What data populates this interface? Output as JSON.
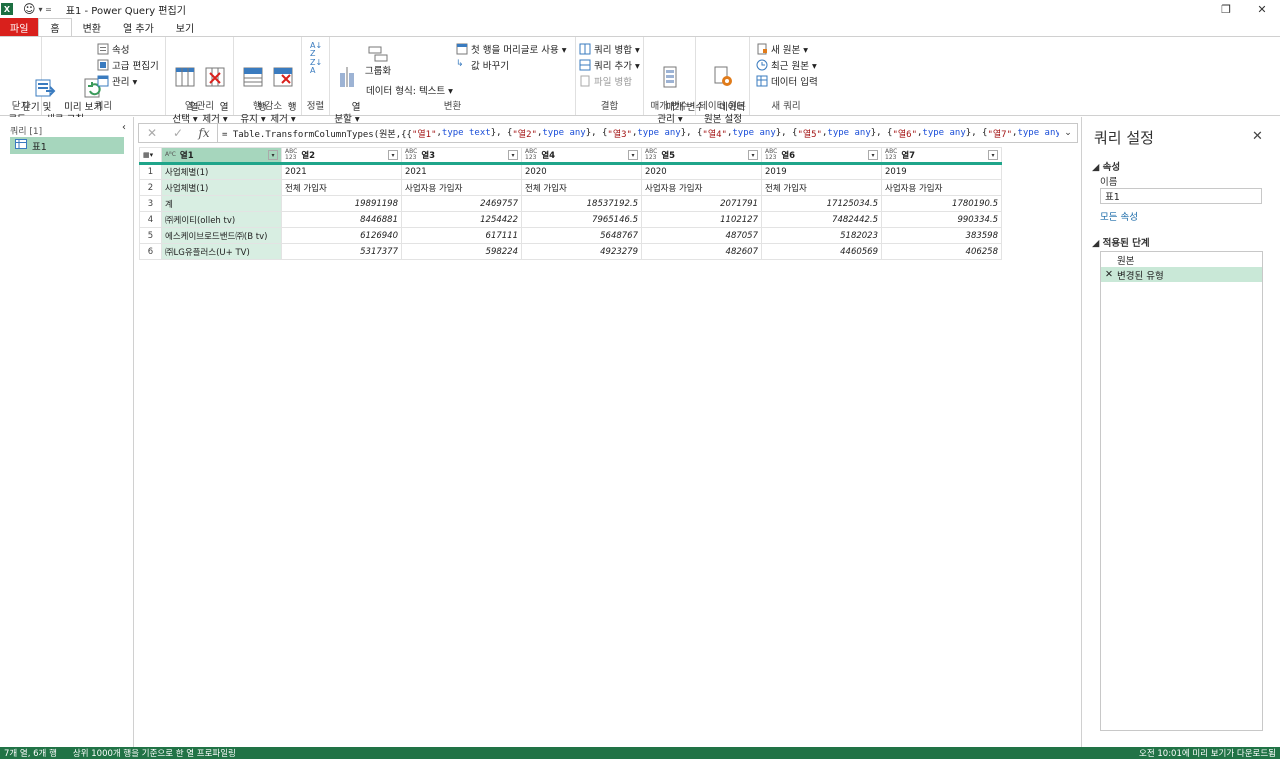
{
  "window": {
    "title": "표1 - Power Query 편집기",
    "xl": "X",
    "qa_arrow": "▾ ="
  },
  "tabs": [
    {
      "label": "파일"
    },
    {
      "label": "홈"
    },
    {
      "label": "변환"
    },
    {
      "label": "열 추가"
    },
    {
      "label": "보기"
    }
  ],
  "ribbon": {
    "close_load": "닫기 및\n로드 ▾",
    "refresh_preview": "미리 보기\n새로 고침 ▾",
    "properties": "속성",
    "advanced_editor": "고급 편집기",
    "manage": "관리 ▾",
    "choose_columns": "열\n선택 ▾",
    "remove_columns": "열\n제거 ▾",
    "keep_rows": "행\n유지 ▾",
    "remove_rows": "행\n제거 ▾",
    "split_column": "열\n분할 ▾",
    "group_by": "그룹화",
    "data_type": "데이터 형식: 텍스트 ▾",
    "first_row_header": "첫 행을 머리글로 사용 ▾",
    "replace_values": "값 바꾸기",
    "merge_queries": "쿼리 병합 ▾",
    "append_queries": "쿼리 추가 ▾",
    "combine_files": "파일 병합",
    "manage_params": "매개 변수\n관리 ▾",
    "data_source_settings": "데이터\n원본 설정",
    "new_source": "새 원본 ▾",
    "recent_sources": "최근 원본 ▾",
    "enter_data": "데이터 입력",
    "groups": {
      "close": "닫기",
      "query": "쿼리",
      "manage_columns": "열 관리",
      "reduce_rows": "행 감소",
      "sort": "정렬",
      "transform": "변환",
      "combine": "결합",
      "parameters": "매개 변수",
      "data_sources": "데이터 원본",
      "new_query": "새 쿼리"
    }
  },
  "queries_pane": {
    "title": "쿼리 [1]",
    "collapse": "‹",
    "item": "표1"
  },
  "formula_bar": {
    "x": "✕",
    "check": "✓",
    "fx": "fx",
    "parts": [
      {
        "t": "= Table.TransformColumnTypes(원본,{{",
        "c": ""
      },
      {
        "t": "\"열1\"",
        "c": "s"
      },
      {
        "t": ", ",
        "c": ""
      },
      {
        "t": "type text",
        "c": "k"
      },
      {
        "t": "}, {",
        "c": ""
      },
      {
        "t": "\"열2\"",
        "c": "s"
      },
      {
        "t": ", ",
        "c": ""
      },
      {
        "t": "type any",
        "c": "k"
      },
      {
        "t": "}, {",
        "c": ""
      },
      {
        "t": "\"열3\"",
        "c": "s"
      },
      {
        "t": ", ",
        "c": ""
      },
      {
        "t": "type any",
        "c": "k"
      },
      {
        "t": "}, {",
        "c": ""
      },
      {
        "t": "\"열4\"",
        "c": "s"
      },
      {
        "t": ", ",
        "c": ""
      },
      {
        "t": "type any",
        "c": "k"
      },
      {
        "t": "}, {",
        "c": ""
      },
      {
        "t": "\"열5\"",
        "c": "s"
      },
      {
        "t": ", ",
        "c": ""
      },
      {
        "t": "type any",
        "c": "k"
      },
      {
        "t": "}, {",
        "c": ""
      },
      {
        "t": "\"열6\"",
        "c": "s"
      },
      {
        "t": ", ",
        "c": ""
      },
      {
        "t": "type any",
        "c": "k"
      },
      {
        "t": "}, {",
        "c": ""
      },
      {
        "t": "\"열7\"",
        "c": "s"
      },
      {
        "t": ", ",
        "c": ""
      },
      {
        "t": "type any",
        "c": "k"
      },
      {
        "t": "}",
        "c": ""
      }
    ],
    "dropdown": "⌄"
  },
  "grid": {
    "corner": "▦▾",
    "columns": [
      {
        "name": "열1",
        "type": "AᴮC"
      },
      {
        "name": "열2",
        "type": "ABC\n123"
      },
      {
        "name": "열3",
        "type": "ABC\n123"
      },
      {
        "name": "열4",
        "type": "ABC\n123"
      },
      {
        "name": "열5",
        "type": "ABC\n123"
      },
      {
        "name": "열6",
        "type": "ABC\n123"
      },
      {
        "name": "열7",
        "type": "ABC\n123"
      }
    ],
    "rows": [
      {
        "n": "1",
        "cells": [
          "사업체별(1)",
          "2021",
          "2021",
          "2020",
          "2020",
          "2019",
          "2019"
        ],
        "num": false
      },
      {
        "n": "2",
        "cells": [
          "사업체별(1)",
          "전체 가입자",
          "사업자용 가입자",
          "전체 가입자",
          "사업자용 가입자",
          "전체 가입자",
          "사업자용 가입자"
        ],
        "num": false
      },
      {
        "n": "3",
        "cells": [
          "계",
          "19891198",
          "2469757",
          "18537192.5",
          "2071791",
          "17125034.5",
          "1780190.5"
        ],
        "num": true
      },
      {
        "n": "4",
        "cells": [
          "㈜케이티(olleh tv)",
          "8446881",
          "1254422",
          "7965146.5",
          "1102127",
          "7482442.5",
          "990334.5"
        ],
        "num": true
      },
      {
        "n": "5",
        "cells": [
          "에스케이브로드밴드㈜(B tv)",
          "6126940",
          "617111",
          "5648767",
          "487057",
          "5182023",
          "383598"
        ],
        "num": true
      },
      {
        "n": "6",
        "cells": [
          "㈜LG유플러스(U+ TV)",
          "5317377",
          "598224",
          "4923279",
          "482607",
          "4460569",
          "406258"
        ],
        "num": true
      }
    ]
  },
  "settings": {
    "title": "쿼리 설정",
    "close": "✕",
    "properties": "◢ 속성",
    "name_label": "이름",
    "name_value": "표1",
    "all_properties": "모든 속성",
    "applied_steps": "◢ 적용된 단계",
    "steps": [
      {
        "label": "원본",
        "sel": false,
        "icon": ""
      },
      {
        "label": "변경된 유형",
        "sel": true,
        "icon": "✕"
      }
    ]
  },
  "status": {
    "left1": "7개 열, 6개 행",
    "left2": "상위 1000개 행을 기준으로 한 열 프로파일링",
    "right": "오전 10:01에 미리 보기가 다운로드됨"
  },
  "colors": {
    "accent": "#217346",
    "file_tab": "#d9201c",
    "sel": "#a6d6bd",
    "header_line": "#1fa58a"
  }
}
